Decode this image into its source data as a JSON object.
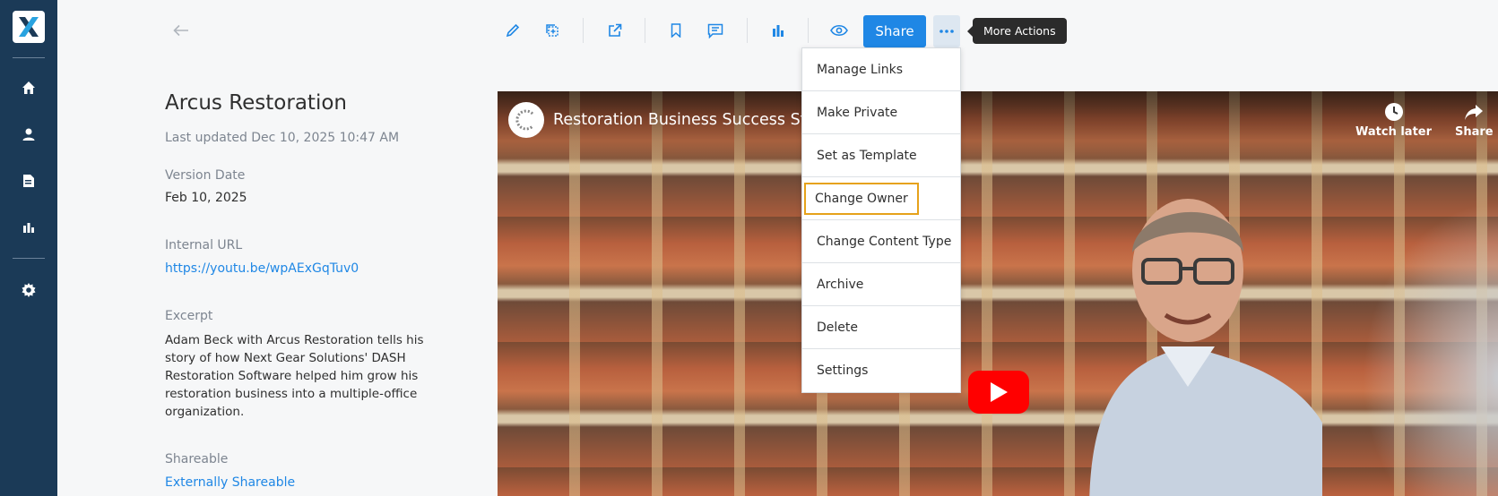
{
  "sidebar": {
    "logo": "X",
    "items": [
      {
        "name": "home-icon"
      },
      {
        "name": "user-icon"
      },
      {
        "name": "document-icon"
      },
      {
        "name": "chart-icon"
      },
      {
        "name": "gear-icon"
      }
    ]
  },
  "toolbar": {
    "share_label": "Share",
    "more_tooltip": "More Actions"
  },
  "details": {
    "title": "Arcus Restoration",
    "last_updated": "Last updated Dec 10, 2025 10:47 AM",
    "version_date_label": "Version Date",
    "version_date": "Feb 10, 2025",
    "internal_url_label": "Internal URL",
    "internal_url": "https://youtu.be/wpAExGqTuv0",
    "excerpt_label": "Excerpt",
    "excerpt": "Adam Beck with Arcus Restoration tells his story of how Next Gear Solutions' DASH Restoration Software helped him grow his restoration business into a multiple-office organization.",
    "shareable_label": "Shareable",
    "shareable_value": "Externally Shareable"
  },
  "video": {
    "title": "Restoration Business Success Stor",
    "watch_later": "Watch later",
    "share": "Share"
  },
  "menu": {
    "items": [
      "Manage Links",
      "Make Private",
      "Set as Template",
      "Change Owner",
      "Change Content Type",
      "Archive",
      "Delete",
      "Settings"
    ],
    "highlighted": "Change Owner"
  },
  "colors": {
    "sidebar": "#1b3a57",
    "accent": "#1f87e5",
    "highlight": "#e6a21b"
  }
}
